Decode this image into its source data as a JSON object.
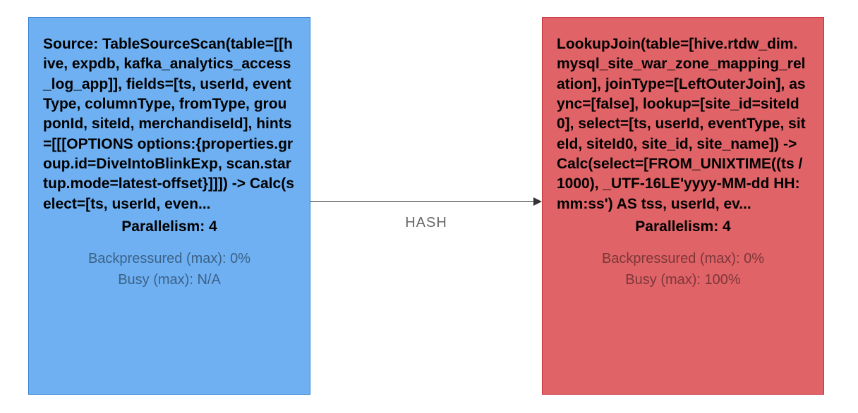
{
  "nodes": {
    "source": {
      "description": "Source: TableSourceScan(table=[[hive, expdb, kafka_analytics_access_log_app]], fields=[ts, userId, eventType, columnType, fromType, grouponId, siteId, merchandiseId], hints=[[[OPTIONS options:{properties.group.id=DiveIntoBlinkExp, scan.startup.mode=latest-offset}]]]) -> Calc(select=[ts, userId, even...",
      "parallelism_label": "Parallelism: 4",
      "backpressure": "Backpressured (max): 0%",
      "busy": "Busy (max): N/A"
    },
    "join": {
      "description": "LookupJoin(table=[hive.rtdw_dim.mysql_site_war_zone_mapping_relation], joinType=[LeftOuterJoin], async=[false], lookup=[site_id=siteId0], select=[ts, userId, eventType, siteId, siteId0, site_id, site_name]) -> Calc(select=[FROM_UNIXTIME((ts / 1000), _UTF-16LE'yyyy-MM-dd HH:mm:ss') AS tss, userId, ev...",
      "parallelism_label": "Parallelism: 4",
      "backpressure": "Backpressured (max): 0%",
      "busy": "Busy (max): 100%"
    }
  },
  "edge": {
    "label": "HASH"
  }
}
